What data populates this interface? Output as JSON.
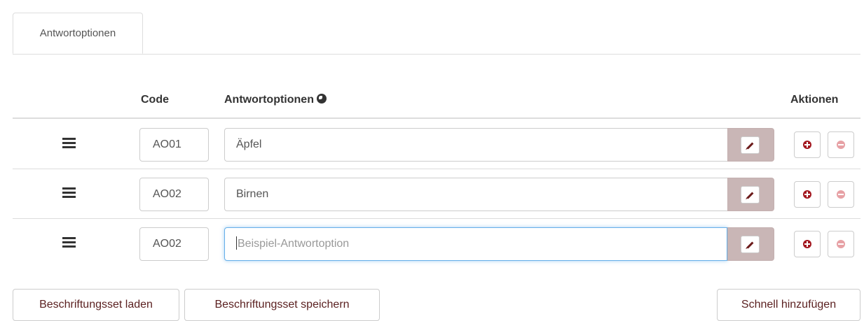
{
  "tabs": [
    {
      "label": "Antwortoptionen"
    }
  ],
  "table": {
    "headers": {
      "code": "Code",
      "answer": "Antwortoptionen",
      "answer_icon": "globe-icon",
      "actions": "Aktionen"
    },
    "rows": [
      {
        "code": "AO01",
        "answer": "Äpfel",
        "placeholder": ""
      },
      {
        "code": "AO02",
        "answer": "Birnen",
        "placeholder": ""
      },
      {
        "code": "AO02",
        "answer": "",
        "placeholder": "Beispiel-Antwortoption"
      }
    ],
    "row_icons": {
      "drag": "drag-handle-icon",
      "edit": "pencil-icon",
      "add": "plus-circle-icon",
      "remove": "minus-circle-icon"
    }
  },
  "footer": {
    "load_label": "Beschriftungsset laden",
    "save_label": "Beschriftungsset speichern",
    "quick_add_label": "Schnell hinzufügen"
  },
  "colors": {
    "edit_addon_bg": "#c9b6b6",
    "add_icon": "#a3171f",
    "remove_icon": "#e7a1a5",
    "focus_border": "#66afe9",
    "button_text": "#5a1f1f"
  }
}
